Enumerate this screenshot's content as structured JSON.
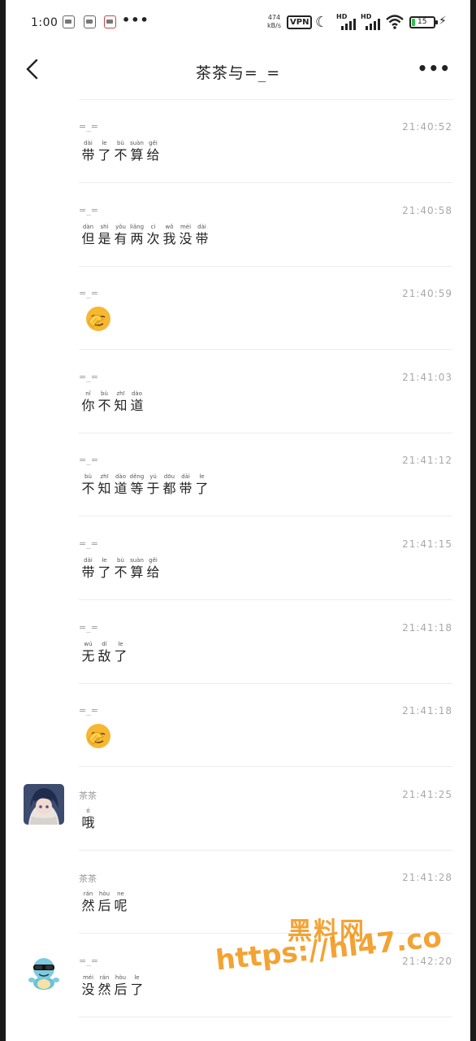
{
  "status_bar": {
    "time": "1:00",
    "more": "•••",
    "speed_value": "474",
    "speed_unit": "kB/s",
    "vpn": "VPN",
    "hd": "HD",
    "battery": "15"
  },
  "header": {
    "title": "茶茶与=_=",
    "more": "•••"
  },
  "messages": [
    {
      "sender": "=_=",
      "time": "21:40:52",
      "chars": [
        [
          "带",
          "dài"
        ],
        [
          "了",
          "le"
        ],
        [
          "不",
          "bù"
        ],
        [
          "算",
          "suàn"
        ],
        [
          "给",
          "gěi"
        ]
      ]
    },
    {
      "sender": "=_=",
      "time": "21:40:58",
      "chars": [
        [
          "但",
          "dàn"
        ],
        [
          "是",
          "shì"
        ],
        [
          "有",
          "yǒu"
        ],
        [
          "两",
          "liǎng"
        ],
        [
          "次",
          "cì"
        ],
        [
          "我",
          "wǒ"
        ],
        [
          "没",
          "méi"
        ],
        [
          "带",
          "dài"
        ]
      ]
    },
    {
      "sender": "=_=",
      "time": "21:40:59",
      "emoji": "facepalm-emoji"
    },
    {
      "sender": "=_=",
      "time": "21:41:03",
      "chars": [
        [
          "你",
          "nǐ"
        ],
        [
          "不",
          "bù"
        ],
        [
          "知",
          "zhī"
        ],
        [
          "道",
          "dào"
        ]
      ]
    },
    {
      "sender": "=_=",
      "time": "21:41:12",
      "chars": [
        [
          "不",
          "bù"
        ],
        [
          "知",
          "zhī"
        ],
        [
          "道",
          "dào"
        ],
        [
          "等",
          "děng"
        ],
        [
          "于",
          "yú"
        ],
        [
          "都",
          "dōu"
        ],
        [
          "带",
          "dài"
        ],
        [
          "了",
          "le"
        ]
      ]
    },
    {
      "sender": "=_=",
      "time": "21:41:15",
      "chars": [
        [
          "带",
          "dài"
        ],
        [
          "了",
          "le"
        ],
        [
          "不",
          "bù"
        ],
        [
          "算",
          "suàn"
        ],
        [
          "给",
          "gěi"
        ]
      ]
    },
    {
      "sender": "=_=",
      "time": "21:41:18",
      "chars": [
        [
          "无",
          "wú"
        ],
        [
          "敌",
          "dí"
        ],
        [
          "了",
          "le"
        ]
      ]
    },
    {
      "sender": "=_=",
      "time": "21:41:18",
      "emoji": "facepalm-emoji"
    },
    {
      "sender": "茶茶",
      "time": "21:41:25",
      "avatar": "anime-avatar",
      "chars": [
        [
          "哦",
          "ó"
        ]
      ]
    },
    {
      "sender": "茶茶",
      "time": "21:41:28",
      "chars": [
        [
          "然",
          "rán"
        ],
        [
          "后",
          "hòu"
        ],
        [
          "呢",
          "ne"
        ]
      ]
    },
    {
      "sender": "=_=",
      "time": "21:42:20",
      "avatar": "squirtle-avatar",
      "chars": [
        [
          "没",
          "méi"
        ],
        [
          "然",
          "rán"
        ],
        [
          "后",
          "hòu"
        ],
        [
          "了",
          "le"
        ]
      ]
    }
  ],
  "watermark": {
    "line1": "黑料网",
    "line2": "https://hl47.co"
  },
  "colors": {
    "watermark": "#f29a1f",
    "battery": "#2bc14a",
    "timestamp": "#a8a8a8"
  }
}
